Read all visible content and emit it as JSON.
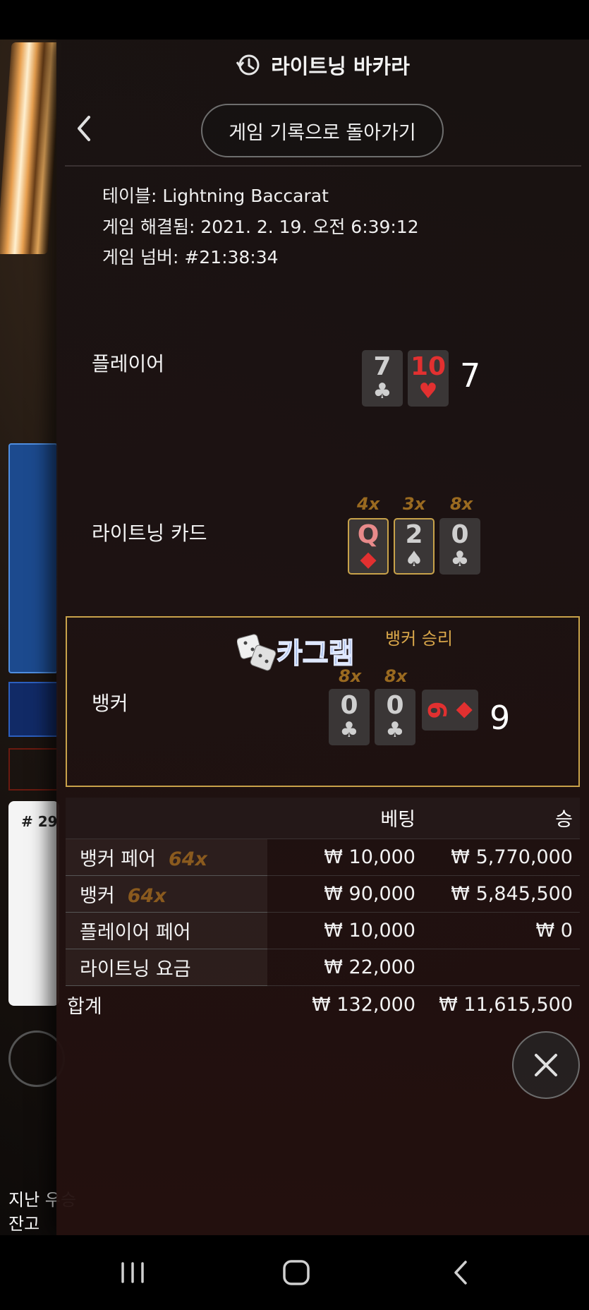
{
  "header": {
    "title": "라이트닝 바카라",
    "history_icon": "history-icon"
  },
  "back_button_label": "게임 기록으로 돌아가기",
  "info": {
    "table": "테이블: Lightning Baccarat",
    "resolved": "게임 해결됨: 2021. 2. 19. 오전 6:39:12",
    "game_number": "게임 넘버: #21:38:34"
  },
  "player": {
    "label": "플레이어",
    "cards": [
      {
        "rank": "7",
        "suit": "♣"
      },
      {
        "rank": "10",
        "suit": "♥"
      }
    ],
    "total": "7"
  },
  "lightning": {
    "label": "라이트닝 카드",
    "cards": [
      {
        "rank": "Q",
        "suit": "◆",
        "multiplier": "4x"
      },
      {
        "rank": "2",
        "suit": "♠",
        "multiplier": "3x"
      },
      {
        "rank": "0",
        "suit": "♣",
        "multiplier": "8x"
      }
    ]
  },
  "banker": {
    "label": "뱅커",
    "result": "뱅커 승리",
    "cards": [
      {
        "rank": "0",
        "suit": "♣",
        "multiplier": "8x"
      },
      {
        "rank": "0",
        "suit": "♣",
        "multiplier": "8x"
      },
      {
        "rank": "9",
        "suit": "◆"
      }
    ],
    "total": "9"
  },
  "watermark_text": "카그램",
  "bets": {
    "headers": {
      "bet": "베팅",
      "win": "승"
    },
    "rows": [
      {
        "label": "뱅커 페어",
        "mult": "64x",
        "bet": "₩ 10,000",
        "win": "₩ 5,770,000"
      },
      {
        "label": "뱅커",
        "mult": "64x",
        "bet": "₩ 90,000",
        "win": "₩ 5,845,500"
      },
      {
        "label": "플레이어 페어",
        "mult": "",
        "bet": "₩ 10,000",
        "win": "₩ 0"
      },
      {
        "label": "라이트닝 요금",
        "mult": "",
        "bet": "₩ 22,000",
        "win": ""
      }
    ],
    "total": {
      "label": "합계",
      "bet": "₩ 132,000",
      "win": "₩ 11,615,500"
    }
  },
  "background": {
    "road_hash": "# 29",
    "last_win_label": "지난 우승",
    "balance_label": "잔고"
  },
  "colors": {
    "gold": "#c8a24a",
    "red": "#e23030",
    "panel": "#1c1414"
  }
}
